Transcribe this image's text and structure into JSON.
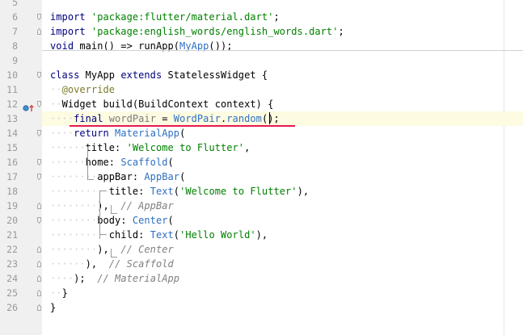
{
  "editor": {
    "lines": [
      {
        "num": "5",
        "fold": "none",
        "tokens": []
      },
      {
        "num": "6",
        "fold": "start",
        "tokens": [
          {
            "t": "import ",
            "c": "kw"
          },
          {
            "t": "'package:flutter/material.dart'",
            "c": "str"
          },
          {
            "t": ";"
          }
        ]
      },
      {
        "num": "7",
        "fold": "end",
        "tokens": [
          {
            "t": "import ",
            "c": "kw"
          },
          {
            "t": "'package:english_words/english_words.dart'",
            "c": "str"
          },
          {
            "t": ";"
          }
        ]
      },
      {
        "num": "8",
        "fold": "none",
        "tokens": [
          {
            "t": "void ",
            "c": "kw"
          },
          {
            "t": "main() => runApp("
          },
          {
            "t": "MyApp",
            "c": "ref"
          },
          {
            "t": "());"
          }
        ]
      },
      {
        "num": "9",
        "fold": "none",
        "tokens": []
      },
      {
        "num": "10",
        "fold": "start",
        "tokens": [
          {
            "t": "class ",
            "c": "kw"
          },
          {
            "t": "MyApp "
          },
          {
            "t": "extends ",
            "c": "kw"
          },
          {
            "t": "StatelessWidget {"
          }
        ]
      },
      {
        "num": "11",
        "fold": "none",
        "tokens": [
          {
            "t": "··",
            "c": "ws"
          },
          {
            "t": "@override",
            "c": "ann"
          }
        ]
      },
      {
        "num": "12",
        "fold": "start",
        "tokens": [
          {
            "t": "··",
            "c": "ws"
          },
          {
            "t": "Widget build(BuildContext context) {"
          }
        ]
      },
      {
        "num": "13",
        "fold": "none",
        "current": true,
        "tokens": [
          {
            "t": "····",
            "c": "ws"
          },
          {
            "t": "final ",
            "c": "kw"
          },
          {
            "t": "wordPair",
            "c": "dim"
          },
          {
            "t": " = "
          },
          {
            "t": "WordPair",
            "c": "ref"
          },
          {
            "t": "."
          },
          {
            "t": "random",
            "c": "ref"
          },
          {
            "t": "();"
          }
        ]
      },
      {
        "num": "14",
        "fold": "start",
        "tokens": [
          {
            "t": "····",
            "c": "ws"
          },
          {
            "t": "return ",
            "c": "kw"
          },
          {
            "t": "MaterialApp",
            "c": "ref"
          },
          {
            "t": "("
          }
        ]
      },
      {
        "num": "15",
        "fold": "none",
        "tokens": [
          {
            "t": "······",
            "c": "ws"
          },
          {
            "t": "title: "
          },
          {
            "t": "'Welcome to Flutter'",
            "c": "str"
          },
          {
            "t": ","
          }
        ]
      },
      {
        "num": "16",
        "fold": "start",
        "tokens": [
          {
            "t": "······",
            "c": "ws"
          },
          {
            "t": "home: "
          },
          {
            "t": "Scaffold",
            "c": "ref"
          },
          {
            "t": "("
          }
        ]
      },
      {
        "num": "17",
        "fold": "start",
        "tokens": [
          {
            "t": "········",
            "c": "ws"
          },
          {
            "t": "appBar: "
          },
          {
            "t": "AppBar",
            "c": "ref"
          },
          {
            "t": "("
          }
        ]
      },
      {
        "num": "18",
        "fold": "none",
        "tokens": [
          {
            "t": "··········",
            "c": "ws"
          },
          {
            "t": "title: "
          },
          {
            "t": "Text",
            "c": "ref"
          },
          {
            "t": "("
          },
          {
            "t": "'Welcome to Flutter'",
            "c": "str"
          },
          {
            "t": "),"
          }
        ]
      },
      {
        "num": "19",
        "fold": "end",
        "tokens": [
          {
            "t": "········",
            "c": "ws"
          },
          {
            "t": "),  "
          },
          {
            "t": "// AppBar",
            "c": "cmt"
          }
        ]
      },
      {
        "num": "20",
        "fold": "start",
        "tokens": [
          {
            "t": "········",
            "c": "ws"
          },
          {
            "t": "body: "
          },
          {
            "t": "Center",
            "c": "ref"
          },
          {
            "t": "("
          }
        ]
      },
      {
        "num": "21",
        "fold": "none",
        "tokens": [
          {
            "t": "··········",
            "c": "ws"
          },
          {
            "t": "child: "
          },
          {
            "t": "Text",
            "c": "ref"
          },
          {
            "t": "("
          },
          {
            "t": "'Hello World'",
            "c": "str"
          },
          {
            "t": "),"
          }
        ]
      },
      {
        "num": "22",
        "fold": "end",
        "tokens": [
          {
            "t": "········",
            "c": "ws"
          },
          {
            "t": "),  "
          },
          {
            "t": "// Center",
            "c": "cmt"
          }
        ]
      },
      {
        "num": "23",
        "fold": "end",
        "tokens": [
          {
            "t": "······",
            "c": "ws"
          },
          {
            "t": "),  "
          },
          {
            "t": "// Scaffold",
            "c": "cmt"
          }
        ]
      },
      {
        "num": "24",
        "fold": "end",
        "tokens": [
          {
            "t": "····",
            "c": "ws"
          },
          {
            "t": ");  "
          },
          {
            "t": "// MaterialApp",
            "c": "cmt"
          }
        ]
      },
      {
        "num": "25",
        "fold": "end",
        "tokens": [
          {
            "t": "··",
            "c": "ws"
          },
          {
            "t": "}"
          }
        ]
      },
      {
        "num": "26",
        "fold": "end",
        "tokens": [
          {
            "t": "}"
          }
        ]
      }
    ]
  },
  "gutter_icons": [
    {
      "line": "12",
      "name": "override-method-icon"
    }
  ],
  "colors": {
    "keyword": "#000080",
    "string": "#008000",
    "reference": "#2e6fc2",
    "comment": "#808080",
    "annotation": "#7a7a2b",
    "current_line": "#fdfbe1",
    "underline": "#e8184f"
  }
}
